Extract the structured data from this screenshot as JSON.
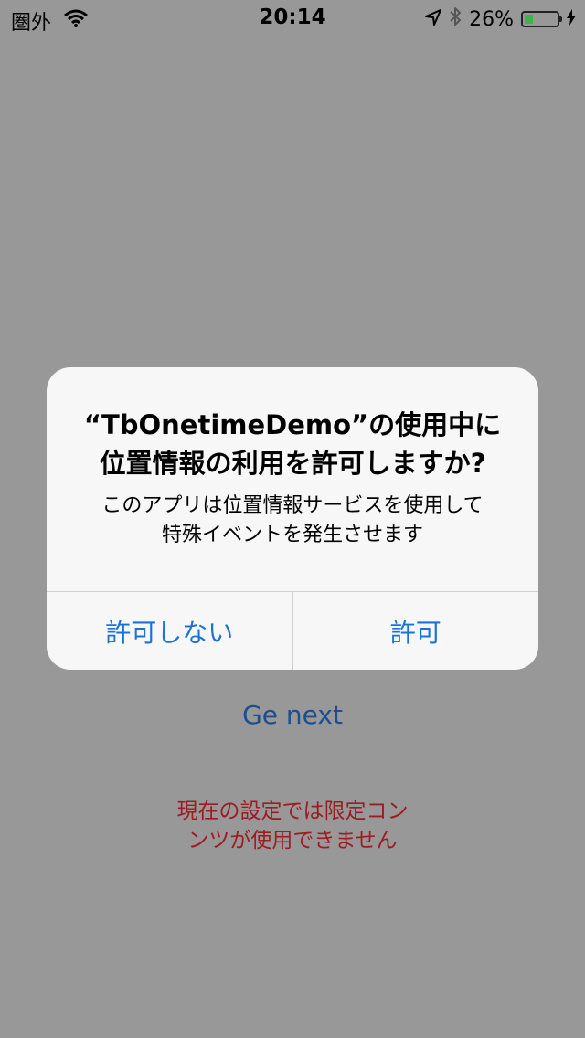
{
  "status_bar": {
    "carrier": "圏外",
    "time": "20:14",
    "battery_percent": "26%",
    "battery_level": 0.26,
    "icons": [
      "wifi-icon",
      "location-arrow-icon",
      "bluetooth-icon",
      "battery-icon",
      "charging-bolt-icon"
    ]
  },
  "page": {
    "next_link": "Ge next",
    "notice": [
      "現在の設定では限定コン",
      "ンツが使用できません"
    ]
  },
  "alert": {
    "title": [
      "“TbOnetimeDemo”の使用中に",
      "位置情報の利用を許可しますか?"
    ],
    "message": [
      "このアプリは位置情報サービスを使用して",
      "特殊イベントを発生させます"
    ],
    "buttons": {
      "deny": "許可しない",
      "allow": "許可"
    }
  },
  "colors": {
    "background": "#989898",
    "link": "#1d4f8e",
    "warning": "#9e1b22",
    "alert_button": "#1a73d9",
    "battery": "#3bb54a"
  }
}
